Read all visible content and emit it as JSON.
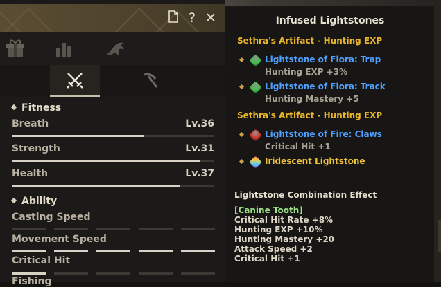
{
  "header": {
    "icons": [
      "document-icon",
      "help-icon",
      "close-icon"
    ],
    "help_label": "?",
    "close_label": "✕"
  },
  "category_icons": [
    "gift-icon",
    "chart-bars-icon",
    "dragon-emblem-icon"
  ],
  "sub_tabs": [
    {
      "icon": "crossed-swords-icon",
      "active": true
    },
    {
      "icon": "pickaxe-icon",
      "active": false
    }
  ],
  "fitness": {
    "title": "Fitness",
    "stats": [
      {
        "label": "Breath",
        "level": "Lv.36",
        "progress": 0.65
      },
      {
        "label": "Strength",
        "level": "Lv.31",
        "progress": 0.93
      },
      {
        "label": "Health",
        "level": "Lv.37",
        "progress": 0.83
      }
    ]
  },
  "ability": {
    "title": "Ability",
    "stats": [
      {
        "label": "Casting Speed",
        "filled_segments": 0,
        "total_segments": 5
      },
      {
        "label": "Movement Speed",
        "filled_segments": 5,
        "total_segments": 5
      },
      {
        "label": "Critical Hit",
        "filled_segments": 1,
        "total_segments": 5
      },
      {
        "label": "Fishing"
      }
    ]
  },
  "tooltip": {
    "title": "Infused Lightstones",
    "sets": [
      {
        "name": "Sethra's Artifact - Hunting EXP",
        "stones": [
          {
            "name": "Lightstone of Flora: Trap",
            "effect": "Hunting EXP +3%",
            "gem_color": "#3fc04a"
          },
          {
            "name": "Lightstone of Flora: Track",
            "effect": "Hunting Mastery +5",
            "gem_color": "#3fc04a"
          }
        ]
      },
      {
        "name": "Sethra's Artifact - Hunting EXP",
        "stones": [
          {
            "name": "Lightstone of Fire: Claws",
            "effect": "Critical Hit +1",
            "gem_color": "#d8322a"
          },
          {
            "name": "Iridescent Lightstone",
            "effect": "",
            "gem_color": "#c050d0"
          }
        ]
      }
    ],
    "combination": {
      "title": "Lightstone Combination Effect",
      "name": "[Canine Tooth]",
      "effects": [
        "Critical Hit Rate +8%",
        "Hunting EXP +10%",
        "Hunting Mastery +20",
        "Attack Speed +2",
        "Critical Hit +1"
      ]
    }
  },
  "colors": {
    "set_name": "#e9b52c",
    "lightstone_blue": "#4fa0ff",
    "iridescent_gold": "#f0c23a",
    "combo_name": "#9ee38a"
  }
}
